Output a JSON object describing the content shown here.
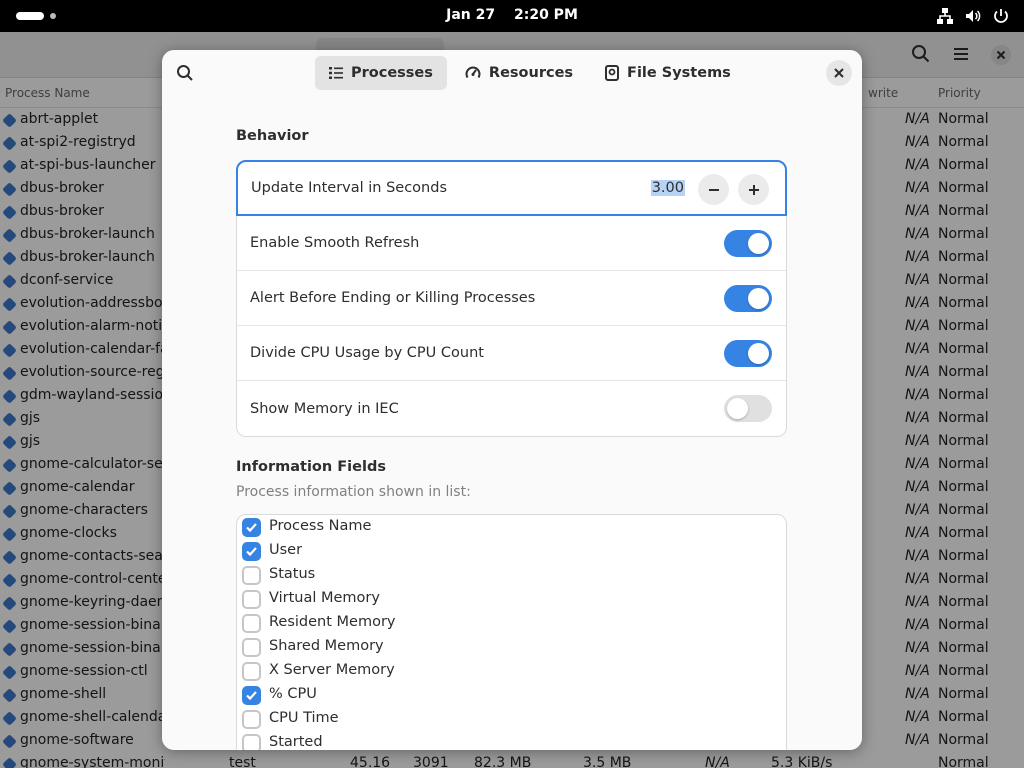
{
  "topbar": {
    "date": "Jan 27",
    "time": "2:20 PM"
  },
  "background": {
    "columns": {
      "process_name": "Process Name",
      "disk_write": "write",
      "priority": "Priority"
    },
    "rows": [
      {
        "name": "abrt-applet",
        "na": "N/A",
        "priority": "Normal"
      },
      {
        "name": "at-spi2-registryd",
        "na": "N/A",
        "priority": "Normal"
      },
      {
        "name": "at-spi-bus-launcher",
        "na": "N/A",
        "priority": "Normal"
      },
      {
        "name": "dbus-broker",
        "na": "N/A",
        "priority": "Normal"
      },
      {
        "name": "dbus-broker",
        "na": "N/A",
        "priority": "Normal"
      },
      {
        "name": "dbus-broker-launch",
        "na": "N/A",
        "priority": "Normal"
      },
      {
        "name": "dbus-broker-launch",
        "na": "N/A",
        "priority": "Normal"
      },
      {
        "name": "dconf-service",
        "na": "N/A",
        "priority": "Normal"
      },
      {
        "name": "evolution-addressboo",
        "na": "N/A",
        "priority": "Normal"
      },
      {
        "name": "evolution-alarm-notif",
        "na": "N/A",
        "priority": "Normal"
      },
      {
        "name": "evolution-calendar-fa",
        "na": "N/A",
        "priority": "Normal"
      },
      {
        "name": "evolution-source-regi",
        "na": "N/A",
        "priority": "Normal"
      },
      {
        "name": "gdm-wayland-session",
        "na": "N/A",
        "priority": "Normal"
      },
      {
        "name": "gjs",
        "na": "N/A",
        "priority": "Normal"
      },
      {
        "name": "gjs",
        "na": "N/A",
        "priority": "Normal"
      },
      {
        "name": "gnome-calculator-sea",
        "na": "N/A",
        "priority": "Normal"
      },
      {
        "name": "gnome-calendar",
        "na": "N/A",
        "priority": "Normal"
      },
      {
        "name": "gnome-characters",
        "na": "N/A",
        "priority": "Normal"
      },
      {
        "name": "gnome-clocks",
        "na": "N/A",
        "priority": "Normal"
      },
      {
        "name": "gnome-contacts-sear",
        "na": "N/A",
        "priority": "Normal"
      },
      {
        "name": "gnome-control-center",
        "na": "N/A",
        "priority": "Normal"
      },
      {
        "name": "gnome-keyring-daem",
        "na": "N/A",
        "priority": "Normal"
      },
      {
        "name": "gnome-session-binar",
        "na": "N/A",
        "priority": "Normal"
      },
      {
        "name": "gnome-session-binar",
        "na": "N/A",
        "priority": "Normal"
      },
      {
        "name": "gnome-session-ctl",
        "na": "N/A",
        "priority": "Normal"
      },
      {
        "name": "gnome-shell",
        "na": "N/A",
        "priority": "Normal"
      },
      {
        "name": "gnome-shell-calendar",
        "na": "N/A",
        "priority": "Normal"
      },
      {
        "name": "gnome-software",
        "na": "N/A",
        "priority": "Normal"
      }
    ],
    "last_row": {
      "name": "gnome-system-monitor",
      "user": "test",
      "cpu": "45.16",
      "id": "3091",
      "memory": "82.3 MB",
      "disk_read": "3.5 MB",
      "na": "N/A",
      "disk_write": "5.3 KiB/s",
      "priority": "Normal"
    }
  },
  "dialog": {
    "tabs": [
      {
        "label": "Processes",
        "icon": "list-icon"
      },
      {
        "label": "Resources",
        "icon": "gauge-icon"
      },
      {
        "label": "File Systems",
        "icon": "drive-icon"
      }
    ],
    "behavior": {
      "title": "Behavior",
      "update_interval": {
        "label": "Update Interval in Seconds",
        "value": "3.00"
      },
      "toggles": [
        {
          "label": "Enable Smooth Refresh",
          "on": true
        },
        {
          "label": "Alert Before Ending or Killing Processes",
          "on": true
        },
        {
          "label": "Divide CPU Usage by CPU Count",
          "on": true
        },
        {
          "label": "Show Memory in IEC",
          "on": false
        }
      ]
    },
    "info_fields": {
      "title": "Information Fields",
      "subtitle": "Process information shown in list:",
      "items": [
        {
          "label": "Process Name",
          "checked": true
        },
        {
          "label": "User",
          "checked": true
        },
        {
          "label": "Status",
          "checked": false
        },
        {
          "label": "Virtual Memory",
          "checked": false
        },
        {
          "label": "Resident Memory",
          "checked": false
        },
        {
          "label": "Shared Memory",
          "checked": false
        },
        {
          "label": "X Server Memory",
          "checked": false
        },
        {
          "label": "% CPU",
          "checked": true
        },
        {
          "label": "CPU Time",
          "checked": false
        },
        {
          "label": "Started",
          "checked": false
        }
      ]
    }
  },
  "colors": {
    "accent": "#3584e4",
    "topbar": "#000000",
    "dialog_bg": "#fafafa"
  }
}
